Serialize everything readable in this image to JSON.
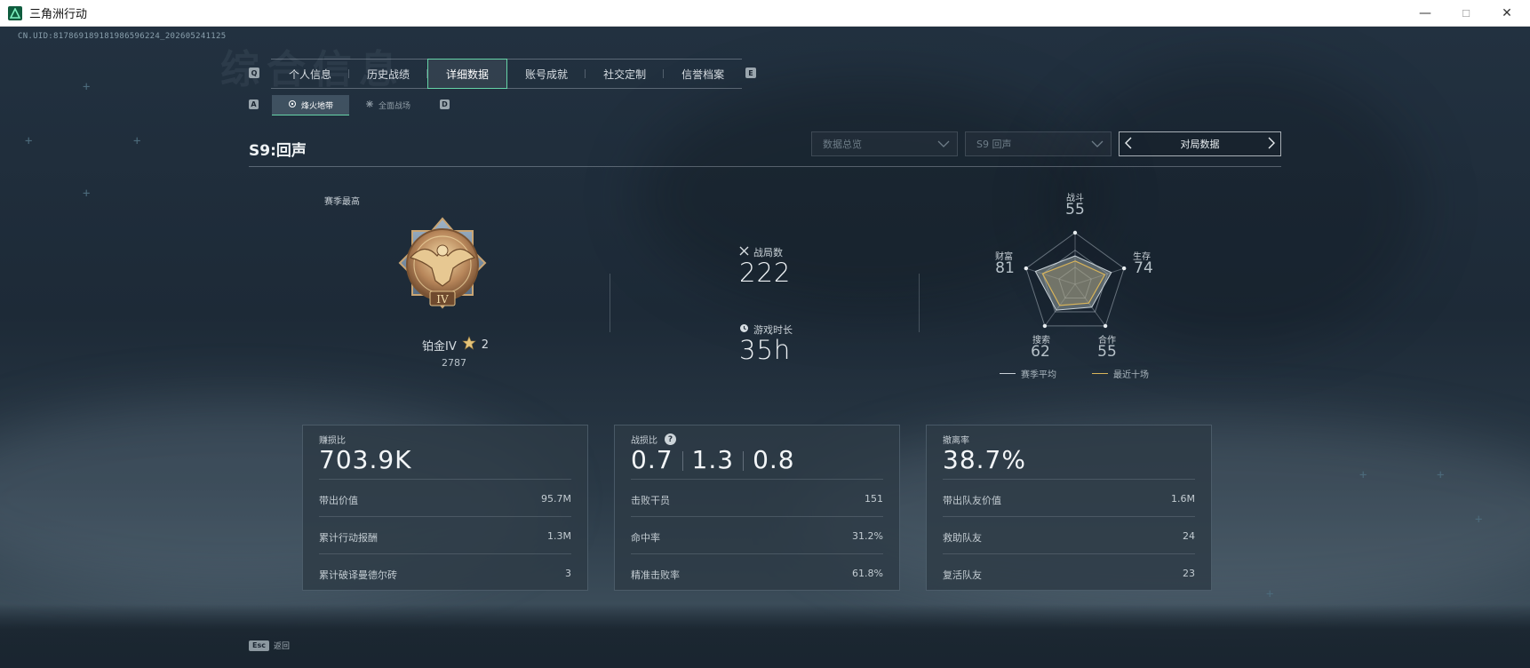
{
  "window": {
    "title": "三角洲行动",
    "minimize": "—",
    "maximize": "☐",
    "close": "✕"
  },
  "uid": "CN.UID:817869189181986596224_20260524112​5",
  "bg_title": "综合信息",
  "main_tabs": {
    "key_left": "Q",
    "key_right": "E",
    "items": [
      "个人信息",
      "历史战绩",
      "详细数据",
      "账号成就",
      "社交定制",
      "信誉档案"
    ],
    "active": "详细数据"
  },
  "sub_tabs": {
    "key_left": "A",
    "key_right": "D",
    "items": [
      {
        "label": "烽火地带",
        "icon": "hazard-zone-icon"
      },
      {
        "label": "全面战场",
        "icon": "warfare-icon"
      }
    ]
  },
  "season": {
    "title": "S9:回声",
    "dropdown_1": "数据总览",
    "dropdown_2": "S9 回声",
    "match_button": "对局数据"
  },
  "rank": {
    "label": "赛季最高",
    "name": "铂金IV",
    "stars": "2",
    "score": "2787",
    "medal_numeral": "IV"
  },
  "summary": {
    "matches_label": "战局数",
    "matches_value": "222",
    "playtime_label": "游戏时长",
    "playtime_value": "35h"
  },
  "radar": {
    "axes": [
      {
        "label": "战斗",
        "value": "55"
      },
      {
        "label": "生存",
        "value": "74"
      },
      {
        "label": "合作",
        "value": "55"
      },
      {
        "label": "搜索",
        "value": "62"
      },
      {
        "label": "财富",
        "value": "81"
      }
    ],
    "legend_avg": "赛季平均",
    "legend_recent": "最近十场",
    "colors": {
      "avg": "#c9d2d8",
      "recent": "#d8b45a"
    }
  },
  "cards": {
    "profit": {
      "title": "赚损比",
      "big": "703.9K",
      "rows": [
        {
          "label": "带出价值",
          "value": "95.7M"
        },
        {
          "label": "累计行动报酬",
          "value": "1.3M"
        },
        {
          "label": "累计破译曼德尔砖",
          "value": "3"
        }
      ]
    },
    "combat": {
      "title": "战损比",
      "help": "?",
      "big": [
        "0.7",
        "1.3",
        "0.8"
      ],
      "rows": [
        {
          "label": "击败干员",
          "value": "151"
        },
        {
          "label": "命中率",
          "value": "31.2%"
        },
        {
          "label": "精准击败率",
          "value": "61.8%"
        }
      ]
    },
    "extract": {
      "title": "撤离率",
      "big": "38.7%",
      "rows": [
        {
          "label": "带出队友价值",
          "value": "1.6M"
        },
        {
          "label": "救助队友",
          "value": "24"
        },
        {
          "label": "复活队友",
          "value": "23"
        }
      ]
    }
  },
  "esc": {
    "key": "Esc",
    "label": "返回"
  }
}
